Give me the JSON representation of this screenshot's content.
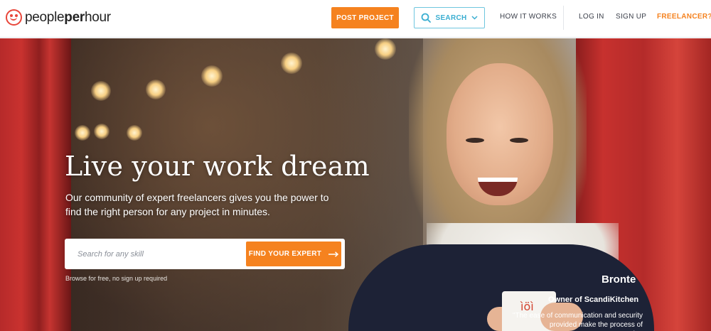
{
  "brand": {
    "name_light": "people",
    "name_bold": "per",
    "name_end": "hour",
    "accent": "#f5821f",
    "logo_color": "#e8463a",
    "search_color": "#3aaed1"
  },
  "header": {
    "post_project": "POST PROJECT",
    "search": "SEARCH",
    "how_it_works": "HOW IT WORKS",
    "log_in": "LOG IN",
    "sign_up": "SIGN UP",
    "freelancer": "FREELANCER?"
  },
  "hero": {
    "title": "Live your work dream",
    "subtitle": "Our community of expert freelancers gives you the power to find the right person for any project in minutes.",
    "search_placeholder": "Search for any skill",
    "find_button": "FIND YOUR EXPERT",
    "browse_note": "Browse for free, no sign up required"
  },
  "testimonial": {
    "name": "Bronte",
    "role": "Owner of ScandiKitchen",
    "quote": "\"The ease of communication and security provided make the process of outsourcing"
  },
  "icons": {
    "search": "search-icon",
    "chevron": "chevron-down-icon",
    "arrow": "arrow-right-icon"
  }
}
